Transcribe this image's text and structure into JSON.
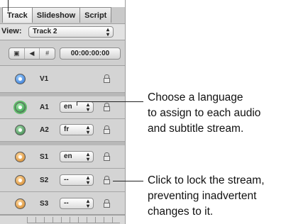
{
  "tabs": [
    {
      "label": "Track"
    },
    {
      "label": "Slideshow"
    },
    {
      "label": "Script"
    }
  ],
  "view": {
    "label": "View:",
    "value": "Track 2"
  },
  "toolbar": {
    "timecode": "00:00:00:00",
    "buttons": [
      "▣",
      "◀",
      "#"
    ]
  },
  "streams": [
    {
      "label": "V1",
      "icon": "video-stream-icon"
    },
    {
      "label": "A1",
      "language": "en",
      "icon": "audio-stream-icon"
    },
    {
      "label": "A2",
      "language": "fr",
      "icon": "audio-stream-icon"
    },
    {
      "label": "S1",
      "language": "en",
      "icon": "subtitle-stream-icon"
    },
    {
      "label": "S2",
      "language": "--",
      "icon": "subtitle-stream-icon"
    },
    {
      "label": "S3",
      "language": "--",
      "icon": "subtitle-stream-icon"
    }
  ],
  "callouts": {
    "language": [
      "Choose a language",
      "to assign to each audio",
      "and subtitle stream."
    ],
    "lock": [
      "Click to lock the stream,",
      "preventing inadvertent",
      "changes to it."
    ]
  }
}
